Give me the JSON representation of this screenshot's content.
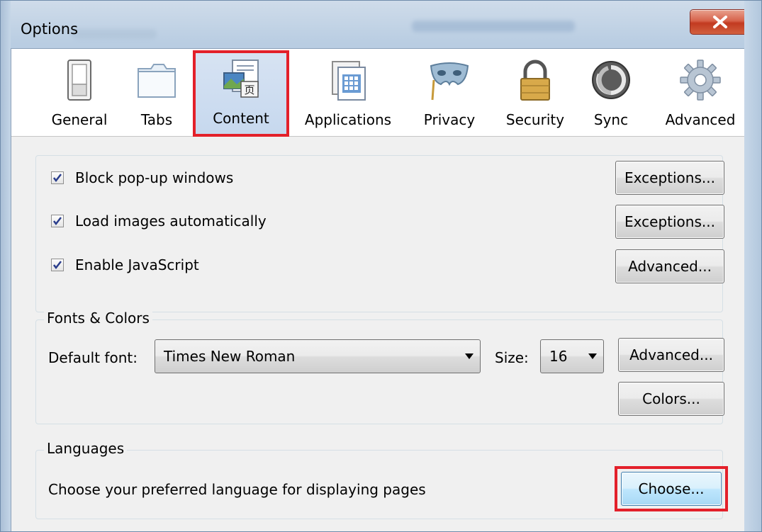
{
  "window": {
    "title": "Options"
  },
  "toolbar": {
    "panes": [
      {
        "label": "General"
      },
      {
        "label": "Tabs"
      },
      {
        "label": "Content"
      },
      {
        "label": "Applications"
      },
      {
        "label": "Privacy"
      },
      {
        "label": "Security"
      },
      {
        "label": "Sync"
      },
      {
        "label": "Advanced"
      }
    ],
    "selected": "Content"
  },
  "content": {
    "popup": {
      "label": "Block pop-up windows",
      "checked": true,
      "button": "Exceptions..."
    },
    "images": {
      "label": "Load images automatically",
      "checked": true,
      "button": "Exceptions..."
    },
    "javascript": {
      "label": "Enable JavaScript",
      "checked": true,
      "button": "Advanced..."
    }
  },
  "fonts": {
    "legend": "Fonts & Colors",
    "default_font_label": "Default font:",
    "default_font_value": "Times New Roman",
    "size_label": "Size:",
    "size_value": "16",
    "advanced_button": "Advanced...",
    "colors_button": "Colors..."
  },
  "languages": {
    "legend": "Languages",
    "description": "Choose your preferred language for displaying pages",
    "choose_button": "Choose..."
  },
  "colors": {
    "highlight_red": "#e3202a",
    "selected_pane_bg": "#c6d8ee"
  }
}
